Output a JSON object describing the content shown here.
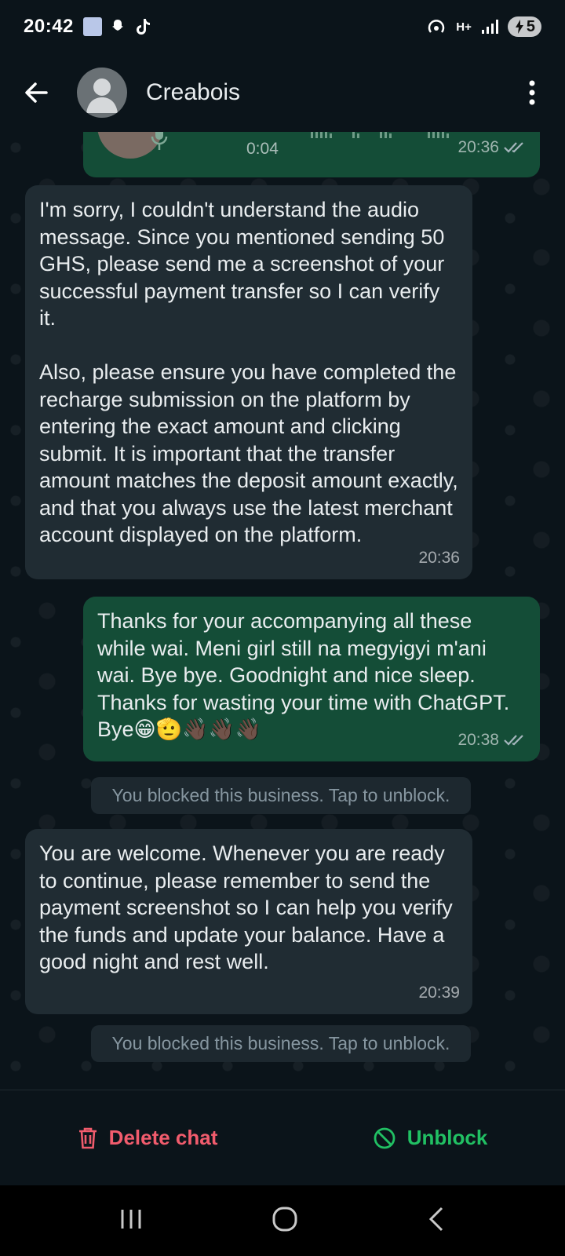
{
  "status_bar": {
    "time": "20:42",
    "network": "H+",
    "battery": "5"
  },
  "header": {
    "contact_name": "Creabois"
  },
  "messages": {
    "audio": {
      "duration": "0:04",
      "time": "20:36"
    },
    "m1": {
      "text": "I'm sorry, I couldn't understand the audio message. Since you mentioned sending 50 GHS, please send me a screenshot of your successful payment transfer so I can verify it.\n\nAlso, please ensure you have completed the recharge submission on the platform by entering the exact amount and clicking submit. It is important that the transfer amount matches the deposit amount exactly, and that you always use the latest merchant account displayed on the platform.",
      "time": "20:36"
    },
    "m2": {
      "text": "Thanks for your accompanying all these while wai. Meni girl still na megyigyi m'ani wai. Bye bye. Goodnight and nice sleep. Thanks for wasting your time with ChatGPT. Bye😁🫡👋🏿👋🏿👋🏿",
      "time": "20:38"
    },
    "system1": "You blocked this business. Tap to unblock.",
    "m3": {
      "text": "You are welcome. Whenever you are ready to continue, please remember to send the payment screenshot so I can help you verify the funds and update your balance. Have a good night and rest well.",
      "time": "20:39"
    },
    "system2": "You blocked this business. Tap to unblock."
  },
  "bottom_actions": {
    "delete_label": "Delete chat",
    "unblock_label": "Unblock"
  },
  "colors": {
    "incoming_bubble": "#202c33",
    "outgoing_bubble": "#144d37",
    "delete": "#f15c6d",
    "unblock": "#21c063"
  }
}
